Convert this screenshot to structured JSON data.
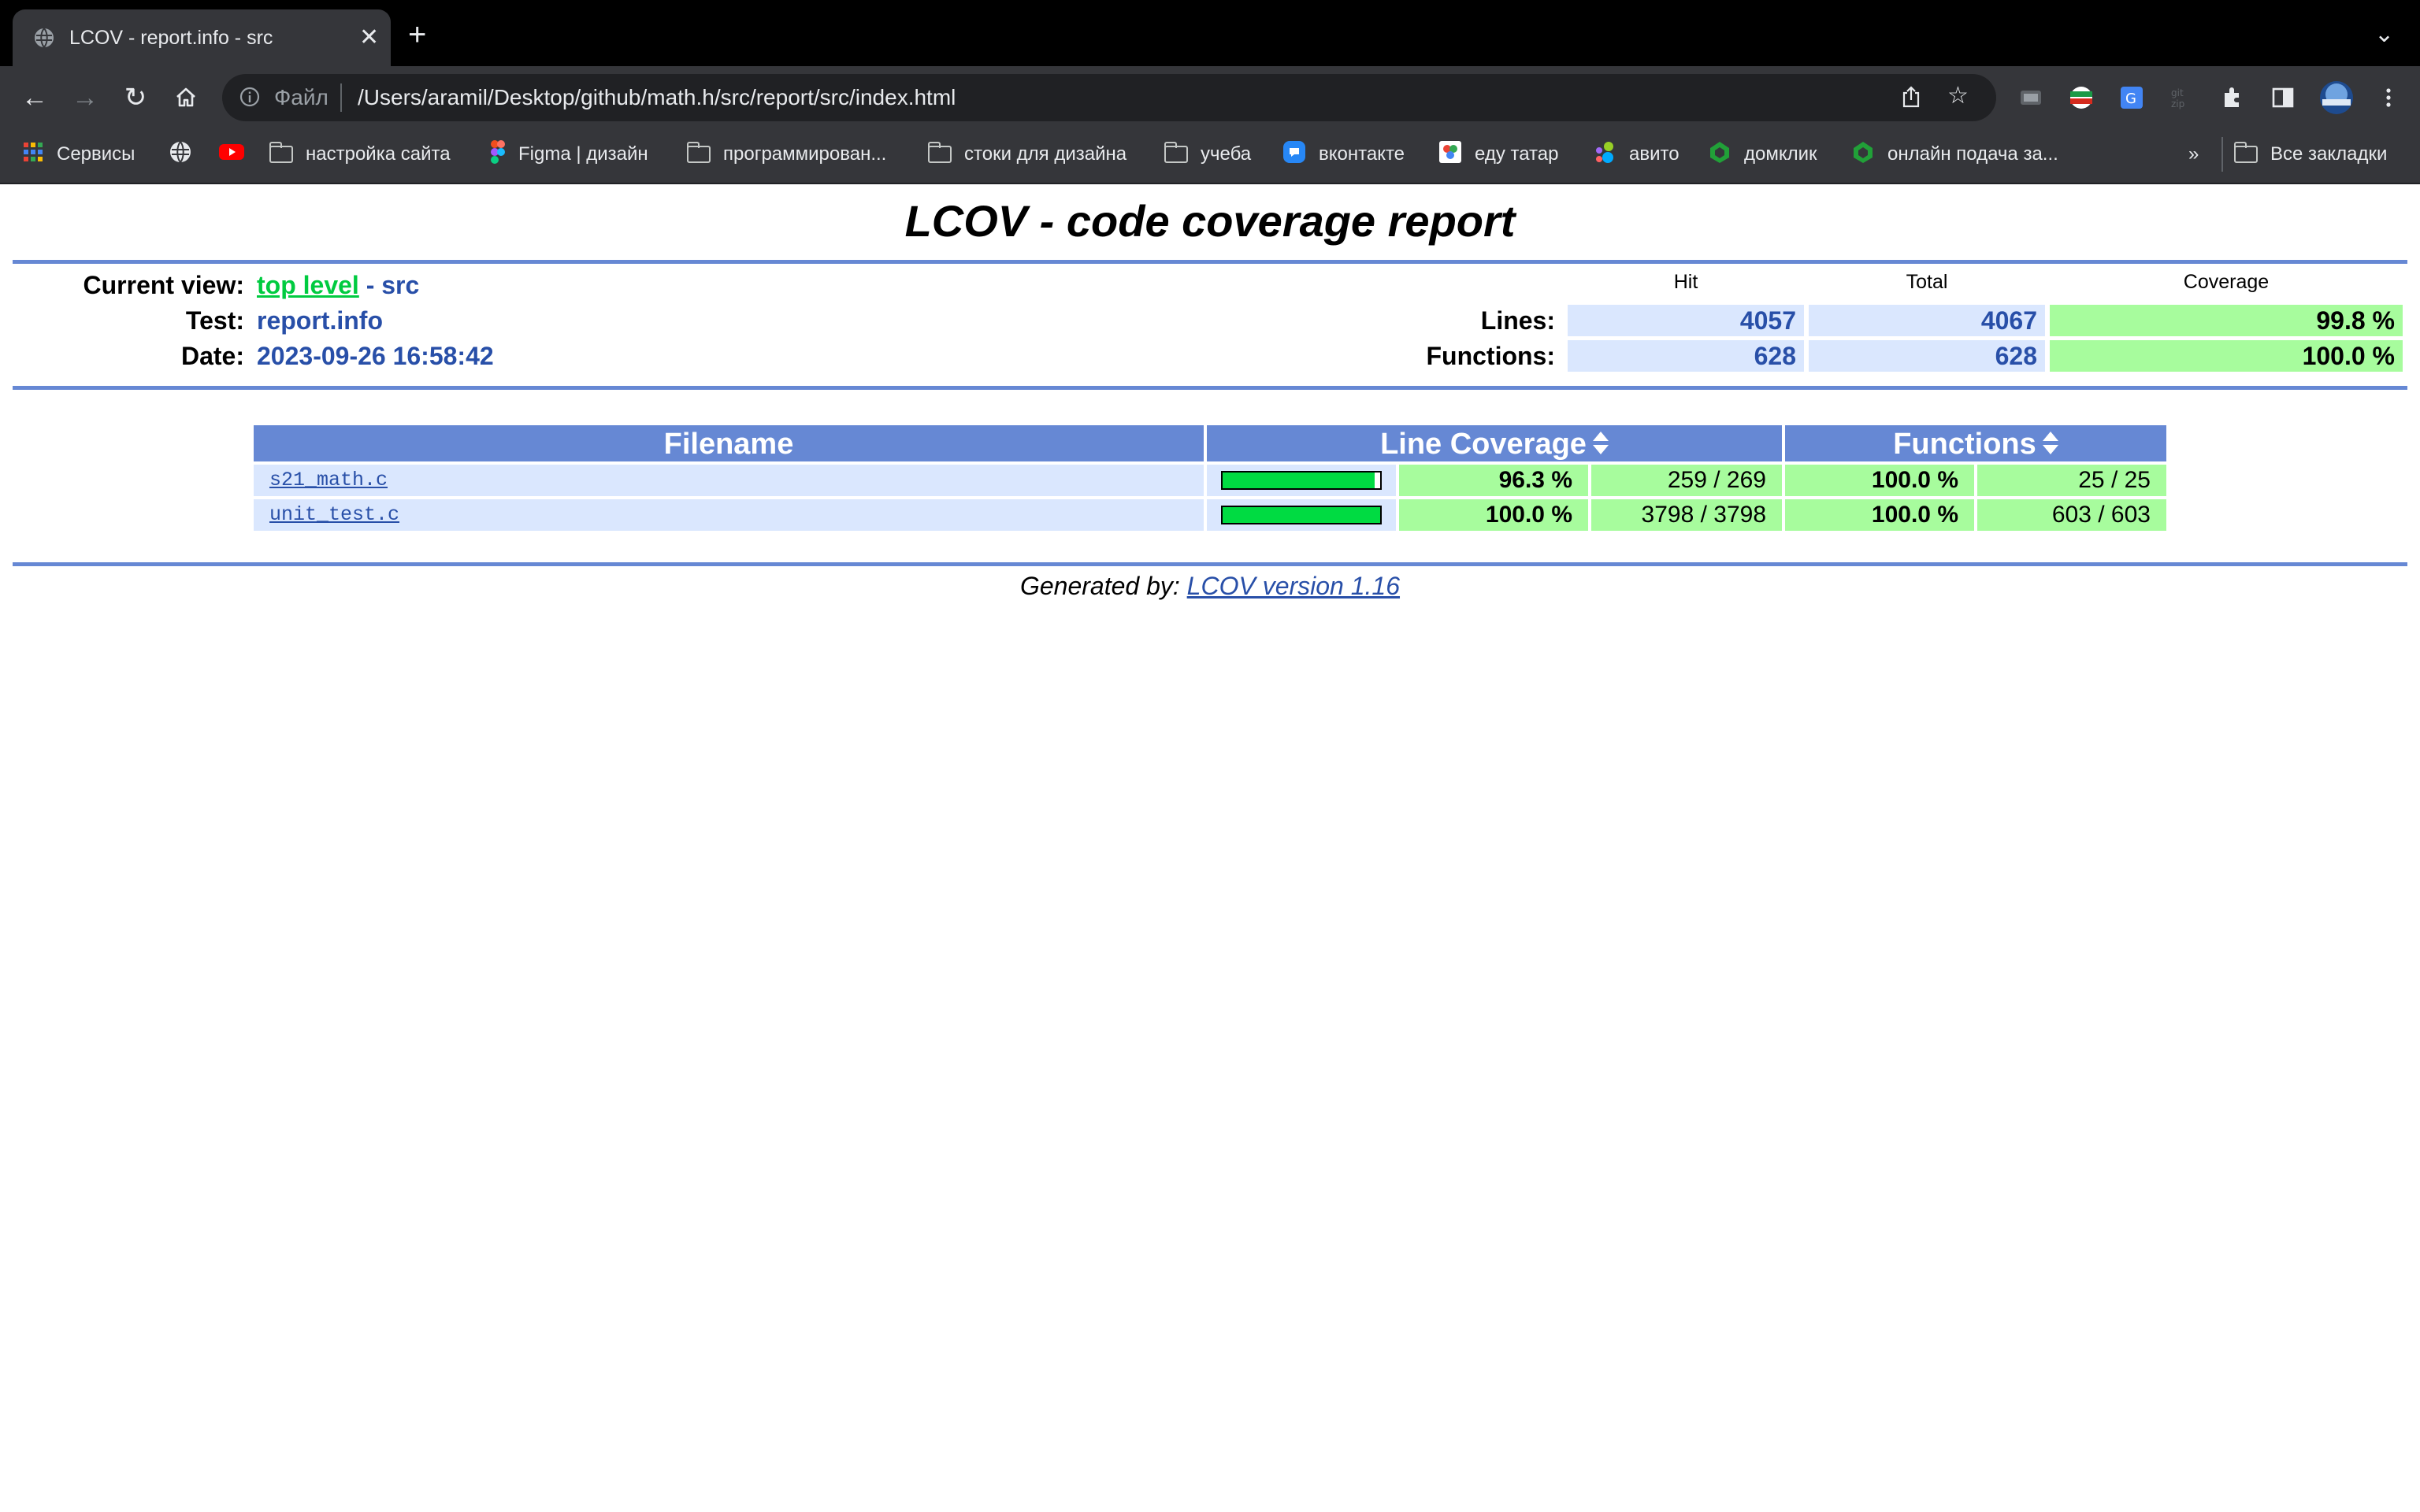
{
  "browser": {
    "tab_title": "LCOV - report.info - src",
    "scheme_label": "Файл",
    "url": "/Users/aramil/Desktop/github/math.h/src/report/src/index.html",
    "bookmarks": [
      {
        "label": "Сервисы",
        "icon": "apps-grid-icon"
      },
      {
        "label": "",
        "icon": "globe-icon"
      },
      {
        "label": "",
        "icon": "youtube-icon"
      },
      {
        "label": "настройка сайта",
        "icon": "folder-icon"
      },
      {
        "label": "Figma | дизайн",
        "icon": "figma-icon"
      },
      {
        "label": "программирован...",
        "icon": "folder-icon"
      },
      {
        "label": "стоки для дизайна",
        "icon": "folder-icon"
      },
      {
        "label": "учеба",
        "icon": "folder-icon"
      },
      {
        "label": "вконтакте",
        "icon": "vk-icon"
      },
      {
        "label": "еду татар",
        "icon": "site-icon"
      },
      {
        "label": "авито",
        "icon": "avito-icon"
      },
      {
        "label": "домклик",
        "icon": "domclick-icon"
      },
      {
        "label": "онлайн подача за...",
        "icon": "domclick-icon"
      }
    ],
    "bookmarks_overflow": "»",
    "all_bookmarks": "Все закладки"
  },
  "report": {
    "title": "LCOV - code coverage report",
    "current_view_label": "Current view:",
    "current_view_link": "top level",
    "current_view_rest": " - src",
    "test_label": "Test:",
    "test_value": "report.info",
    "date_label": "Date:",
    "date_value": "2023-09-26 16:58:42",
    "summary": {
      "hit_header": "Hit",
      "total_header": "Total",
      "coverage_header": "Coverage",
      "lines_label": "Lines:",
      "lines_hit": "4057",
      "lines_total": "4067",
      "lines_coverage": "99.8 %",
      "functions_label": "Functions:",
      "functions_hit": "628",
      "functions_total": "628",
      "functions_coverage": "100.0 %"
    },
    "table": {
      "headers": {
        "filename": "Filename",
        "line_coverage": "Line Coverage",
        "functions": "Functions"
      },
      "rows": [
        {
          "filename": "s21_math.c",
          "bar_fraction": 0.963,
          "line_pct": "96.3 %",
          "line_count": "259 / 269",
          "func_pct": "100.0 %",
          "func_count": "25 / 25"
        },
        {
          "filename": "unit_test.c",
          "bar_fraction": 1.0,
          "line_pct": "100.0 %",
          "line_count": "3798 / 3798",
          "func_pct": "100.0 %",
          "func_count": "603 / 603"
        }
      ]
    },
    "footer_prefix": "Generated by: ",
    "footer_link": "LCOV version 1.16"
  }
}
